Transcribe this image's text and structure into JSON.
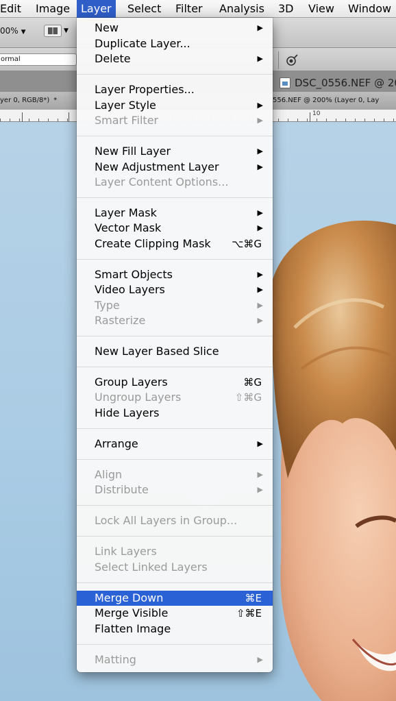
{
  "menubar": {
    "items": [
      "Edit",
      "Image",
      "Layer",
      "Select",
      "Filter",
      "Analysis",
      "3D",
      "View",
      "Window"
    ]
  },
  "options": {
    "zoom": "00%",
    "blend_mode": "ormal"
  },
  "tabs": {
    "left": "yer 0, RGB/8*)",
    "left_marker": "*",
    "window_title": "DSC_0556.NEF @ 20",
    "right": "556.NEF @ 200% (Layer 0, Lay"
  },
  "ruler": {
    "label": "10"
  },
  "menu": {
    "items": [
      {
        "label": "New",
        "submenu": true,
        "enabled": true
      },
      {
        "label": "Duplicate Layer...",
        "enabled": true
      },
      {
        "label": "Delete",
        "submenu": true,
        "enabled": true
      },
      {
        "label": "Layer Properties...",
        "enabled": true
      },
      {
        "label": "Layer Style",
        "submenu": true,
        "enabled": true
      },
      {
        "label": "Smart Filter",
        "submenu": true,
        "enabled": false
      },
      {
        "label": "New Fill Layer",
        "submenu": true,
        "enabled": true
      },
      {
        "label": "New Adjustment Layer",
        "submenu": true,
        "enabled": true
      },
      {
        "label": "Layer Content Options...",
        "enabled": false
      },
      {
        "label": "Layer Mask",
        "submenu": true,
        "enabled": true
      },
      {
        "label": "Vector Mask",
        "submenu": true,
        "enabled": true
      },
      {
        "label": "Create Clipping Mask",
        "shortcut": "⌥⌘G",
        "enabled": true
      },
      {
        "label": "Smart Objects",
        "submenu": true,
        "enabled": true
      },
      {
        "label": "Video Layers",
        "submenu": true,
        "enabled": true
      },
      {
        "label": "Type",
        "submenu": true,
        "enabled": false
      },
      {
        "label": "Rasterize",
        "submenu": true,
        "enabled": false
      },
      {
        "label": "New Layer Based Slice",
        "enabled": true
      },
      {
        "label": "Group Layers",
        "shortcut": "⌘G",
        "enabled": true
      },
      {
        "label": "Ungroup Layers",
        "shortcut": "⇧⌘G",
        "enabled": false
      },
      {
        "label": "Hide Layers",
        "enabled": true
      },
      {
        "label": "Arrange",
        "submenu": true,
        "enabled": true
      },
      {
        "label": "Align",
        "submenu": true,
        "enabled": false
      },
      {
        "label": "Distribute",
        "submenu": true,
        "enabled": false
      },
      {
        "label": "Lock All Layers in Group...",
        "enabled": false
      },
      {
        "label": "Link Layers",
        "enabled": false
      },
      {
        "label": "Select Linked Layers",
        "enabled": false
      },
      {
        "label": "Merge Down",
        "shortcut": "⌘E",
        "enabled": true,
        "highlighted": true
      },
      {
        "label": "Merge Visible",
        "shortcut": "⇧⌘E",
        "enabled": true
      },
      {
        "label": "Flatten Image",
        "enabled": true
      },
      {
        "label": "Matting",
        "submenu": true,
        "enabled": false
      }
    ],
    "submenu_glyph": "▶"
  },
  "colors": {
    "menu_highlight": "#2a62d6",
    "disabled_text": "#9a9a9a",
    "canvas_sky": "#b6d2e7"
  }
}
